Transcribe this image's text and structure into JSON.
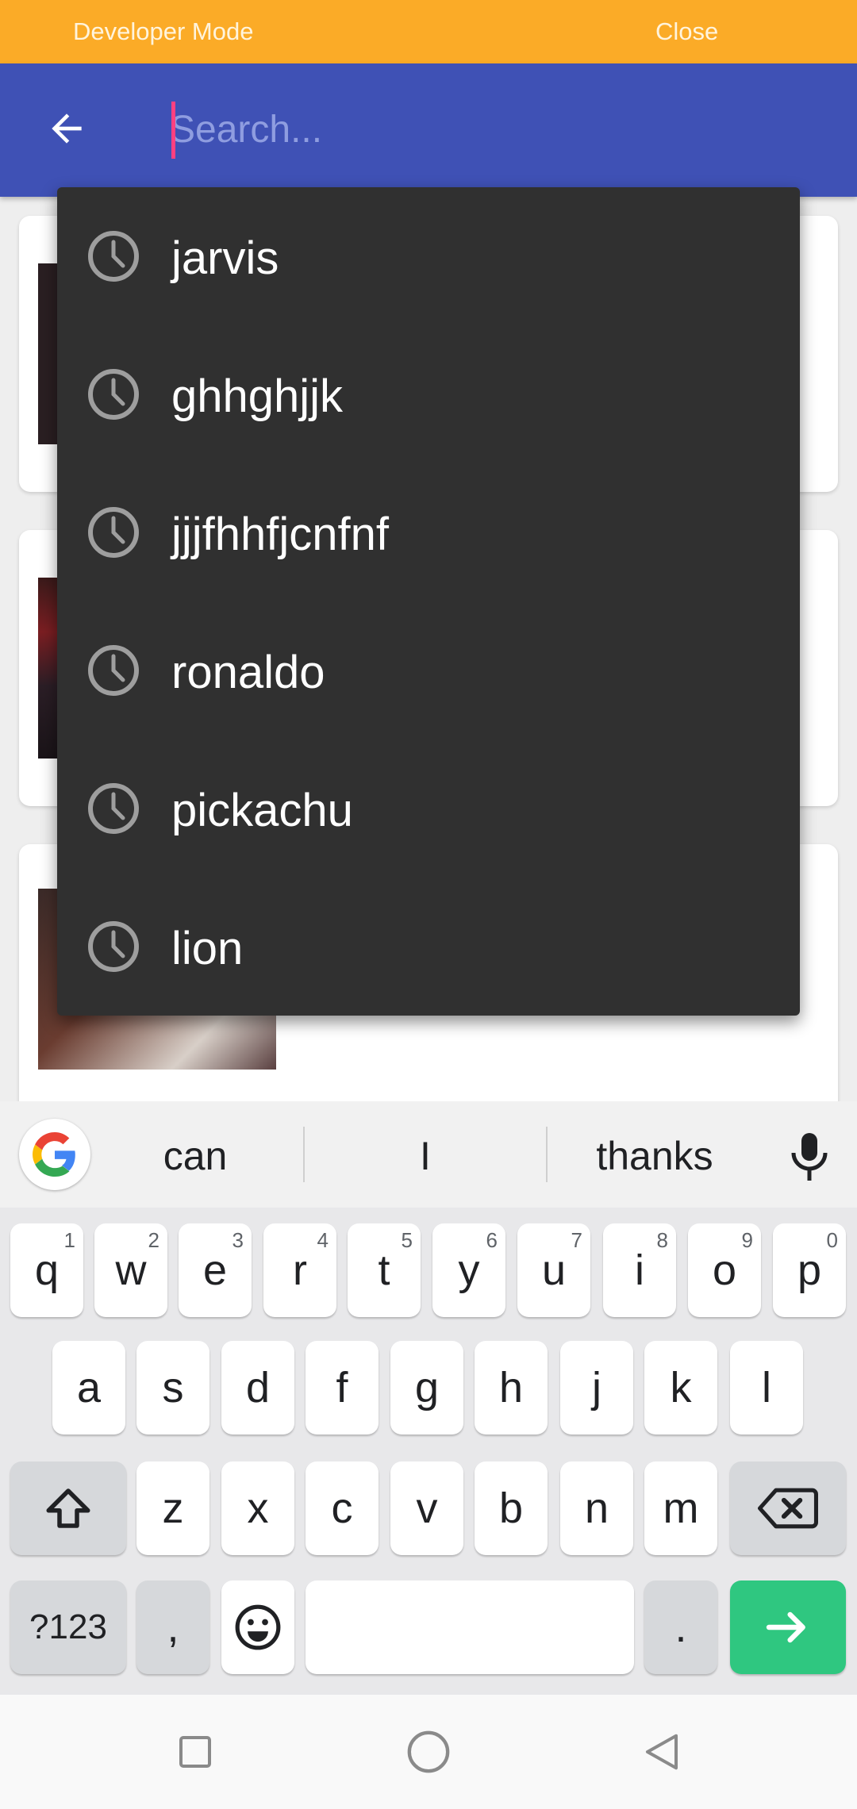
{
  "dev_banner": {
    "label": "Developer Mode",
    "close": "Close"
  },
  "search": {
    "placeholder": "Search...",
    "value": ""
  },
  "suggestions": [
    "jarvis",
    "ghhghjjk",
    "jjjfhhfjcnfnf",
    "ronaldo",
    "pickachu",
    "lion"
  ],
  "keyboard": {
    "suggestions": [
      "can",
      "I",
      "thanks"
    ],
    "row1": [
      {
        "label": "q",
        "hint": "1"
      },
      {
        "label": "w",
        "hint": "2"
      },
      {
        "label": "e",
        "hint": "3"
      },
      {
        "label": "r",
        "hint": "4"
      },
      {
        "label": "t",
        "hint": "5"
      },
      {
        "label": "y",
        "hint": "6"
      },
      {
        "label": "u",
        "hint": "7"
      },
      {
        "label": "i",
        "hint": "8"
      },
      {
        "label": "o",
        "hint": "9"
      },
      {
        "label": "p",
        "hint": "0"
      }
    ],
    "row2": [
      "a",
      "s",
      "d",
      "f",
      "g",
      "h",
      "j",
      "k",
      "l"
    ],
    "row3": [
      "z",
      "x",
      "c",
      "v",
      "b",
      "n",
      "m"
    ],
    "symbols_key": "?123",
    "comma_key": ",",
    "period_key": "."
  },
  "colors": {
    "dev_banner": "#fbab27",
    "app_bar": "#3f51b5",
    "cursor": "#ff4081",
    "dropdown": "#303030",
    "enter_key": "#2fc780"
  },
  "icons": {
    "back": "arrow-left-icon",
    "history": "clock-icon",
    "google": "google-g-icon",
    "mic": "microphone-icon",
    "shift": "shift-icon",
    "backspace": "backspace-icon",
    "emoji": "emoji-icon",
    "enter": "arrow-right-icon",
    "recents": "square-icon",
    "home": "circle-icon",
    "back_nav": "triangle-back-icon"
  }
}
